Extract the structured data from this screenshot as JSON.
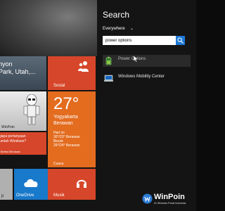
{
  "start": {
    "nature_text": "nyon\nPark, Utah,...",
    "blog_label": "WinPoin",
    "red_small_text": "gapa pertanyaan\numlah Windows?",
    "red_small_sub": "Berita Windows",
    "social_label": "Sosial",
    "weather": {
      "temp": "27°",
      "city": "Yogyakarta",
      "condition": "Berawan",
      "today_label": "Hari ini",
      "today_value": "30°/23° Berawan",
      "tomorrow_label": "Besok",
      "tomorrow_value": "29°/24° Berawan",
      "label": "Cuaca"
    },
    "onedrive_label": "OneDrive",
    "music_label": "Musik",
    "small_label": "p"
  },
  "search": {
    "title": "Search",
    "scope": "Everywhere",
    "query": "power options",
    "results": [
      {
        "label": "Power Options",
        "icon": "battery-icon"
      },
      {
        "label": "Windows Mobility Center",
        "icon": "mobility-center-icon"
      }
    ]
  },
  "watermark": {
    "name": "WinPoin",
    "sub": "#1 Windows Portal Indonesia"
  },
  "colors": {
    "tile_red": "#d6462a",
    "tile_orange": "#e36c1f",
    "tile_blue": "#1979ca",
    "search_button": "#1e78d7",
    "panel_bg": "#141414"
  }
}
